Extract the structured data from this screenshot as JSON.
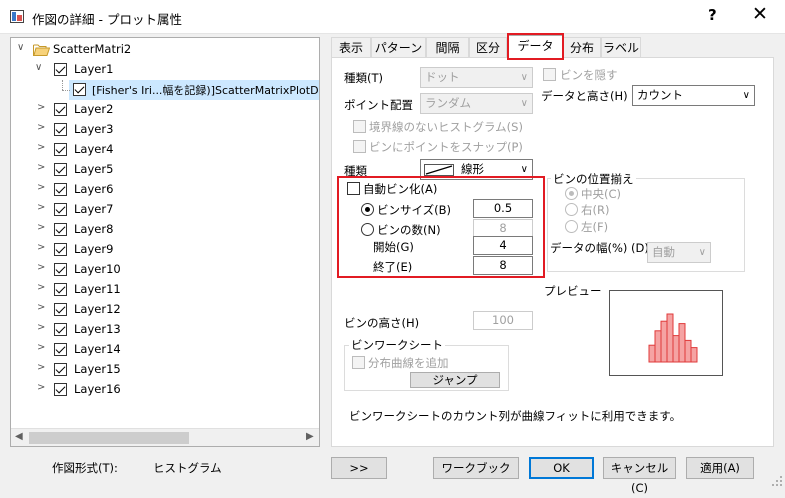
{
  "window": {
    "title": "作図の詳細 - プロット属性",
    "help": "?",
    "close": "✕"
  },
  "tree": {
    "root": "ScatterMatri2",
    "layer1": "Layer1",
    "plot": "[Fisher's Iri...幅を記録)]ScatterMatrixPlotDa",
    "layers": [
      "Layer2",
      "Layer3",
      "Layer4",
      "Layer5",
      "Layer6",
      "Layer7",
      "Layer8",
      "Layer9",
      "Layer10",
      "Layer11",
      "Layer12",
      "Layer13",
      "Layer14",
      "Layer15",
      "Layer16"
    ]
  },
  "tabs": [
    "表示",
    "パターン",
    "間隔",
    "区分",
    "データ",
    "分布",
    "ラベル"
  ],
  "active_tab": "データ",
  "data_tab": {
    "type_label": "種類(T)",
    "type_value": "ドット",
    "point_layout_label": "ポイント配置",
    "point_layout_value": "ランダム",
    "hide_bins_label": "ビンを隠す",
    "data_height_label": "データと高さ(H)",
    "data_height_value": "カウント",
    "borderless_hist_label": "境界線のないヒストグラム(S)",
    "snap_points_label": "ビンにポイントをスナップ(P)",
    "kind_label": "種類",
    "kind_value": "線形",
    "auto_bin_label": "自動ビン化(A)",
    "bin_size_label": "ビンサイズ(B)",
    "bin_size_value": "0.5",
    "bin_count_label": "ビンの数(N)",
    "bin_count_value": "8",
    "start_label": "開始(G)",
    "start_value": "4",
    "end_label": "終了(E)",
    "end_value": "8",
    "bin_align_label": "ビンの位置揃え",
    "align_center": "中央(C)",
    "align_right": "右(R)",
    "align_left": "左(F)",
    "data_width_label": "データの幅(%) (D)",
    "data_width_value": "自動",
    "preview_label": "プレビュー",
    "bin_height_label": "ビンの高さ(H)",
    "bin_height_value": "100",
    "worksheet_group_label": "ビンワークシート",
    "add_curve_label": "分布曲線を追加",
    "jump_button": "ジャンプ",
    "footer_note": "ビンワークシートのカウント列が曲線フィットに利用できます。"
  },
  "preview_bars": [
    0.35,
    0.65,
    0.85,
    1.0,
    0.55,
    0.8,
    0.45,
    0.3
  ],
  "bottom": {
    "plot_type_label": "作図形式(T):",
    "plot_type_value": "ヒストグラム",
    "more_button": ">>",
    "workbook_button": "ワークブック",
    "ok_button": "OK",
    "cancel_button": "キャンセル(C)",
    "apply_button": "適用(A)"
  },
  "colors": {
    "highlight": "#e21b23",
    "accent": "#0078d7",
    "bar_fill": "#f5a3a3",
    "bar_stroke": "#e03a3a"
  }
}
